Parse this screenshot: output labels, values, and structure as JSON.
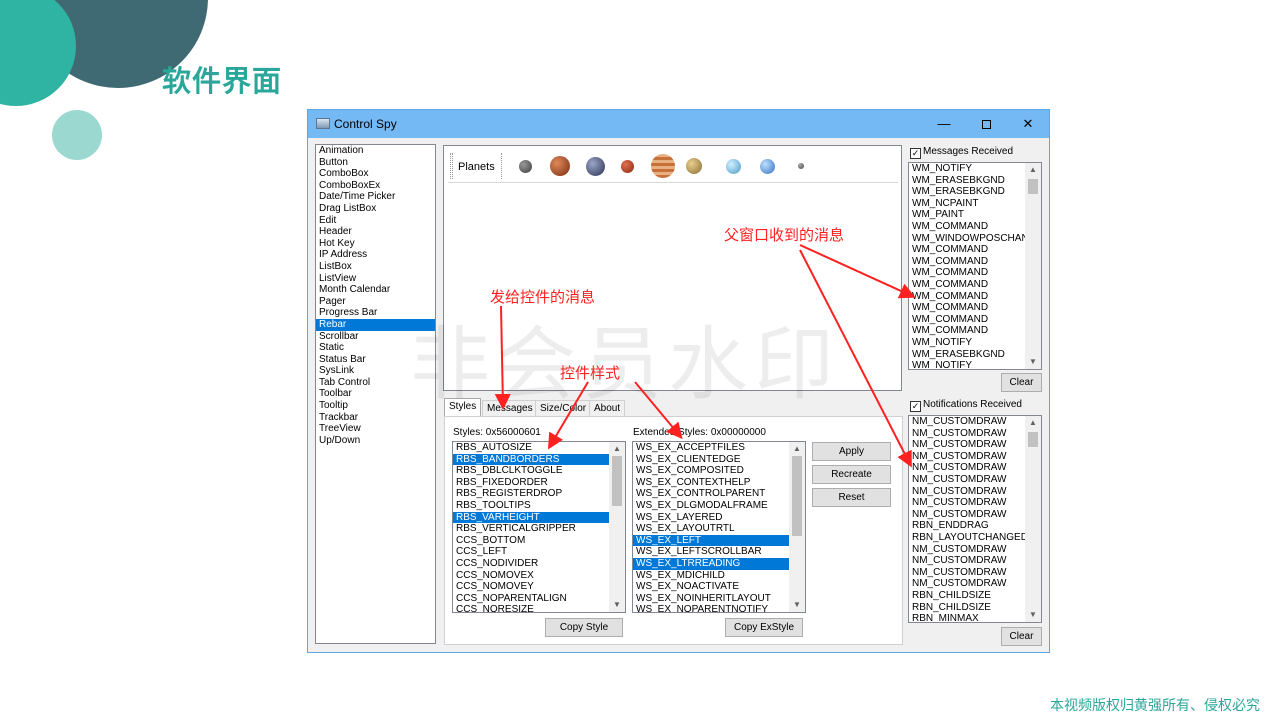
{
  "slide": {
    "title": "软件界面",
    "copyright": "本视频版权归黄强所有、侵权必究",
    "watermark": "非会员水印",
    "accent": "#2aa79a"
  },
  "window": {
    "title": "Control Spy",
    "minimize": "—",
    "close": "✕"
  },
  "control_list": {
    "items": [
      "Animation",
      "Button",
      "ComboBox",
      "ComboBoxEx",
      "Date/Time Picker",
      "Drag ListBox",
      "Edit",
      "Header",
      "Hot Key",
      "IP Address",
      "ListBox",
      "ListView",
      "Month Calendar",
      "Pager",
      "Progress Bar",
      "Rebar",
      "Scrollbar",
      "Static",
      "Status Bar",
      "SysLink",
      "Tab Control",
      "Toolbar",
      "Tooltip",
      "Trackbar",
      "TreeView",
      "Up/Down"
    ],
    "selected": "Rebar"
  },
  "rebar": {
    "band_label": "Planets",
    "planet_icons": [
      "mercury-icon",
      "venus-icon",
      "earth-icon",
      "mars-icon",
      "jupiter-icon",
      "saturn-icon",
      "uranus-icon",
      "neptune-icon",
      "pluto-icon"
    ]
  },
  "tabs": [
    "Styles",
    "Messages",
    "Size/Color",
    "About"
  ],
  "styles": {
    "label": "Styles: 0x56000601",
    "items": [
      "RBS_AUTOSIZE",
      "RBS_BANDBORDERS",
      "RBS_DBLCLKTOGGLE",
      "RBS_FIXEDORDER",
      "RBS_REGISTERDROP",
      "RBS_TOOLTIPS",
      "RBS_VARHEIGHT",
      "RBS_VERTICALGRIPPER",
      "CCS_BOTTOM",
      "CCS_LEFT",
      "CCS_NODIVIDER",
      "CCS_NOMOVEX",
      "CCS_NOMOVEY",
      "CCS_NOPARENTALIGN",
      "CCS_NORESIZE"
    ],
    "selected": [
      "RBS_BANDBORDERS",
      "RBS_VARHEIGHT"
    ],
    "copy_button": "Copy Style"
  },
  "ex_styles": {
    "label": "Extended Styles: 0x00000000",
    "items": [
      "WS_EX_ACCEPTFILES",
      "WS_EX_CLIENTEDGE",
      "WS_EX_COMPOSITED",
      "WS_EX_CONTEXTHELP",
      "WS_EX_CONTROLPARENT",
      "WS_EX_DLGMODALFRAME",
      "WS_EX_LAYERED",
      "WS_EX_LAYOUTRTL",
      "WS_EX_LEFT",
      "WS_EX_LEFTSCROLLBAR",
      "WS_EX_LTRREADING",
      "WS_EX_MDICHILD",
      "WS_EX_NOACTIVATE",
      "WS_EX_NOINHERITLAYOUT",
      "WS_EX_NOPARENTNOTIFY"
    ],
    "selected": [
      "WS_EX_LEFT",
      "WS_EX_LTRREADING"
    ],
    "copy_button": "Copy ExStyle"
  },
  "actions": {
    "apply": "Apply",
    "recreate": "Recreate",
    "reset": "Reset"
  },
  "messages": {
    "label": "Messages Received",
    "items": [
      "WM_NOTIFY",
      "WM_ERASEBKGND",
      "WM_ERASEBKGND",
      "WM_NCPAINT",
      "WM_PAINT",
      "WM_COMMAND",
      "WM_WINDOWPOSCHANGI",
      "WM_COMMAND",
      "WM_COMMAND",
      "WM_COMMAND",
      "WM_COMMAND",
      "WM_COMMAND",
      "WM_COMMAND",
      "WM_COMMAND",
      "WM_COMMAND",
      "WM_NOTIFY",
      "WM_ERASEBKGND",
      "WM_NOTIFY"
    ],
    "clear_button": "Clear"
  },
  "notifications": {
    "label": "Notifications Received",
    "items": [
      "NM_CUSTOMDRAW",
      "NM_CUSTOMDRAW",
      "NM_CUSTOMDRAW",
      "NM_CUSTOMDRAW",
      "NM_CUSTOMDRAW",
      "NM_CUSTOMDRAW",
      "NM_CUSTOMDRAW",
      "NM_CUSTOMDRAW",
      "NM_CUSTOMDRAW",
      "RBN_ENDDRAG",
      "RBN_LAYOUTCHANGED",
      "NM_CUSTOMDRAW",
      "NM_CUSTOMDRAW",
      "NM_CUSTOMDRAW",
      "NM_CUSTOMDRAW",
      "RBN_CHILDSIZE",
      "RBN_CHILDSIZE",
      "RBN_MINMAX"
    ],
    "clear_button": "Clear"
  },
  "annotations": {
    "parent_messages": "父窗口收到的消息",
    "send_messages": "发给控件的消息",
    "control_styles": "控件样式"
  }
}
